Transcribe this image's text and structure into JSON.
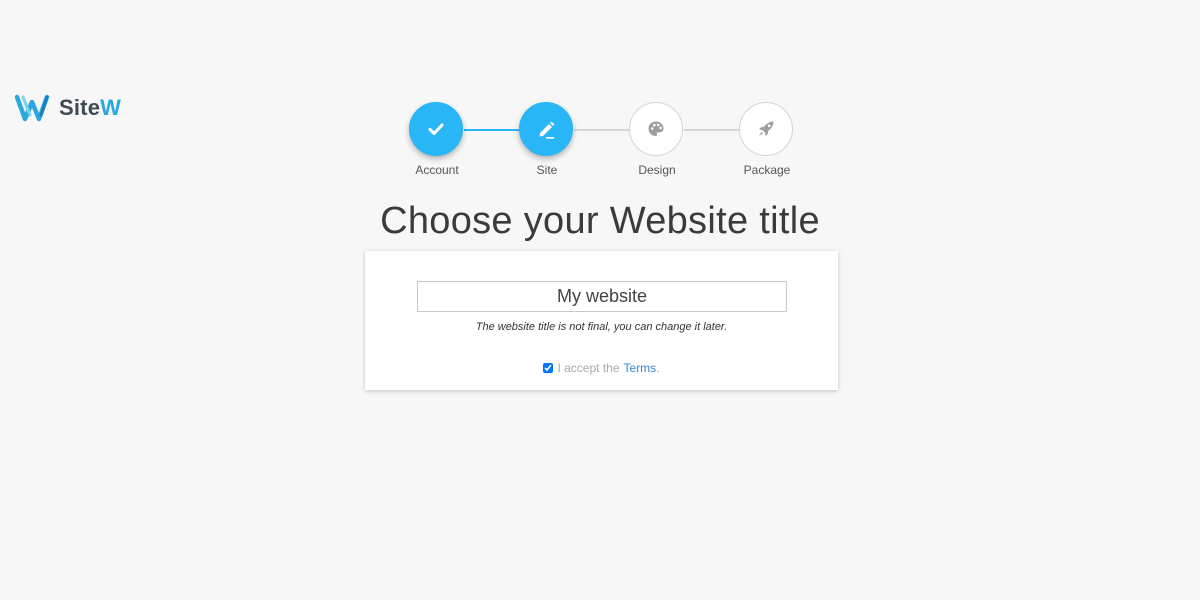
{
  "brand": {
    "name_part1": "Site",
    "name_part2": "W",
    "accent_color": "#29a8e0"
  },
  "stepper": {
    "active_color": "#29b6f6",
    "steps": [
      {
        "label": "Account",
        "icon": "check-icon",
        "state": "completed"
      },
      {
        "label": "Site",
        "icon": "pencil-icon",
        "state": "current"
      },
      {
        "label": "Design",
        "icon": "palette-icon",
        "state": "pending"
      },
      {
        "label": "Package",
        "icon": "rocket-icon",
        "state": "pending"
      }
    ]
  },
  "main": {
    "title": "Choose your Website title",
    "title_input_value": "My website",
    "hint": "The website title is not final, you can change it later.",
    "terms_checked": true,
    "terms_text": "I accept the",
    "terms_link": "Terms",
    "terms_suffix": "."
  }
}
